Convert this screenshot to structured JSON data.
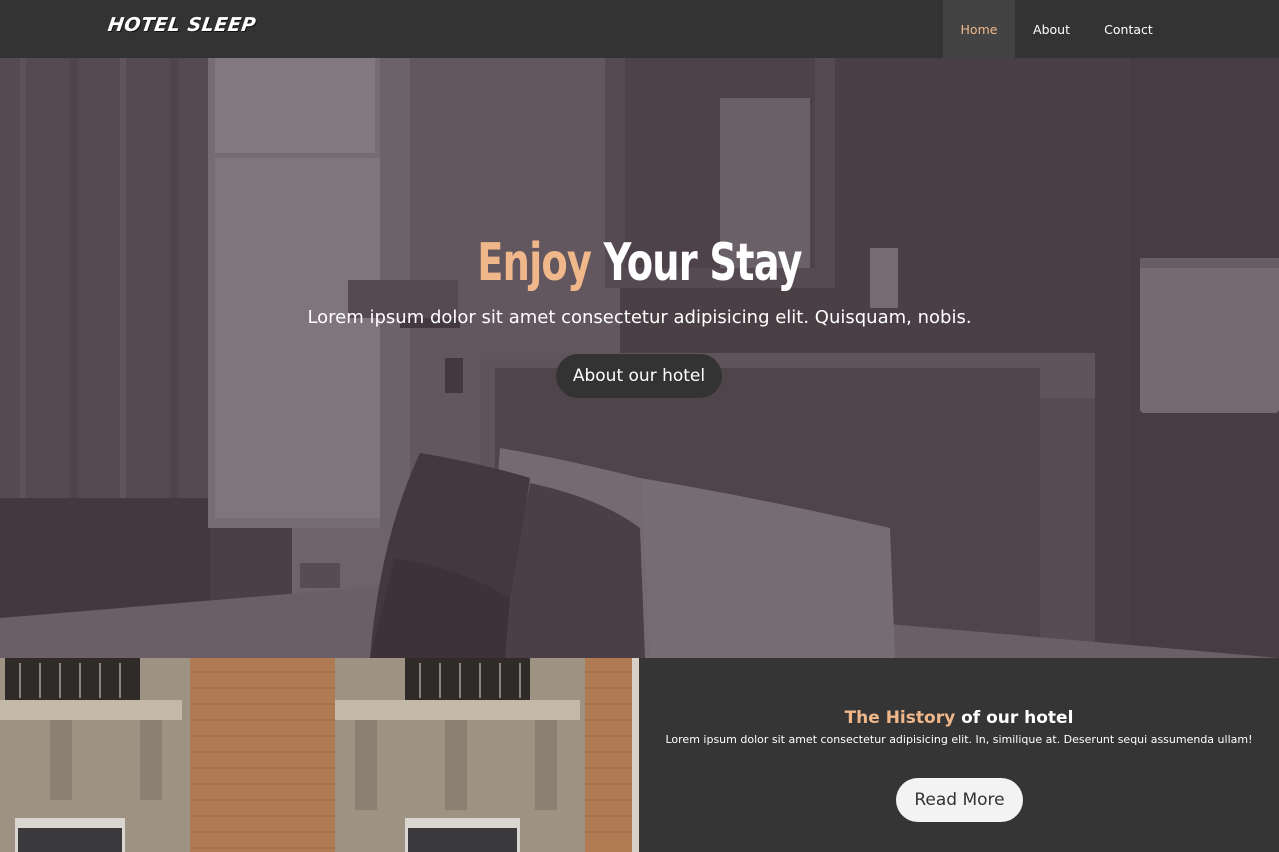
{
  "nav": {
    "brand": "HOTEL SLEEP",
    "items": [
      {
        "label": "Home",
        "active": true
      },
      {
        "label": "About",
        "active": false
      },
      {
        "label": "Contact",
        "active": false
      }
    ]
  },
  "hero": {
    "title_accent": "Enjoy",
    "title_rest": " Your Stay",
    "subtitle": "Lorem ipsum dolor sit amet consectetur adipisicing elit. Quisquam, nobis.",
    "button_label": "About our hotel",
    "image": "hotel-room-photo"
  },
  "history": {
    "title_accent": "The History",
    "title_rest": " of our hotel",
    "text": "Lorem ipsum dolor sit amet consectetur adipisicing elit. In, similique at. Deserunt sequi assumenda ullam!",
    "button_label": "Read More",
    "image": "building-facade-photo"
  },
  "colors": {
    "accent": "#f0b88a",
    "nav_bg": "#333333",
    "nav_active_bg": "#434343",
    "panel_bg": "#353535",
    "hero_tint": "#4d4149"
  }
}
